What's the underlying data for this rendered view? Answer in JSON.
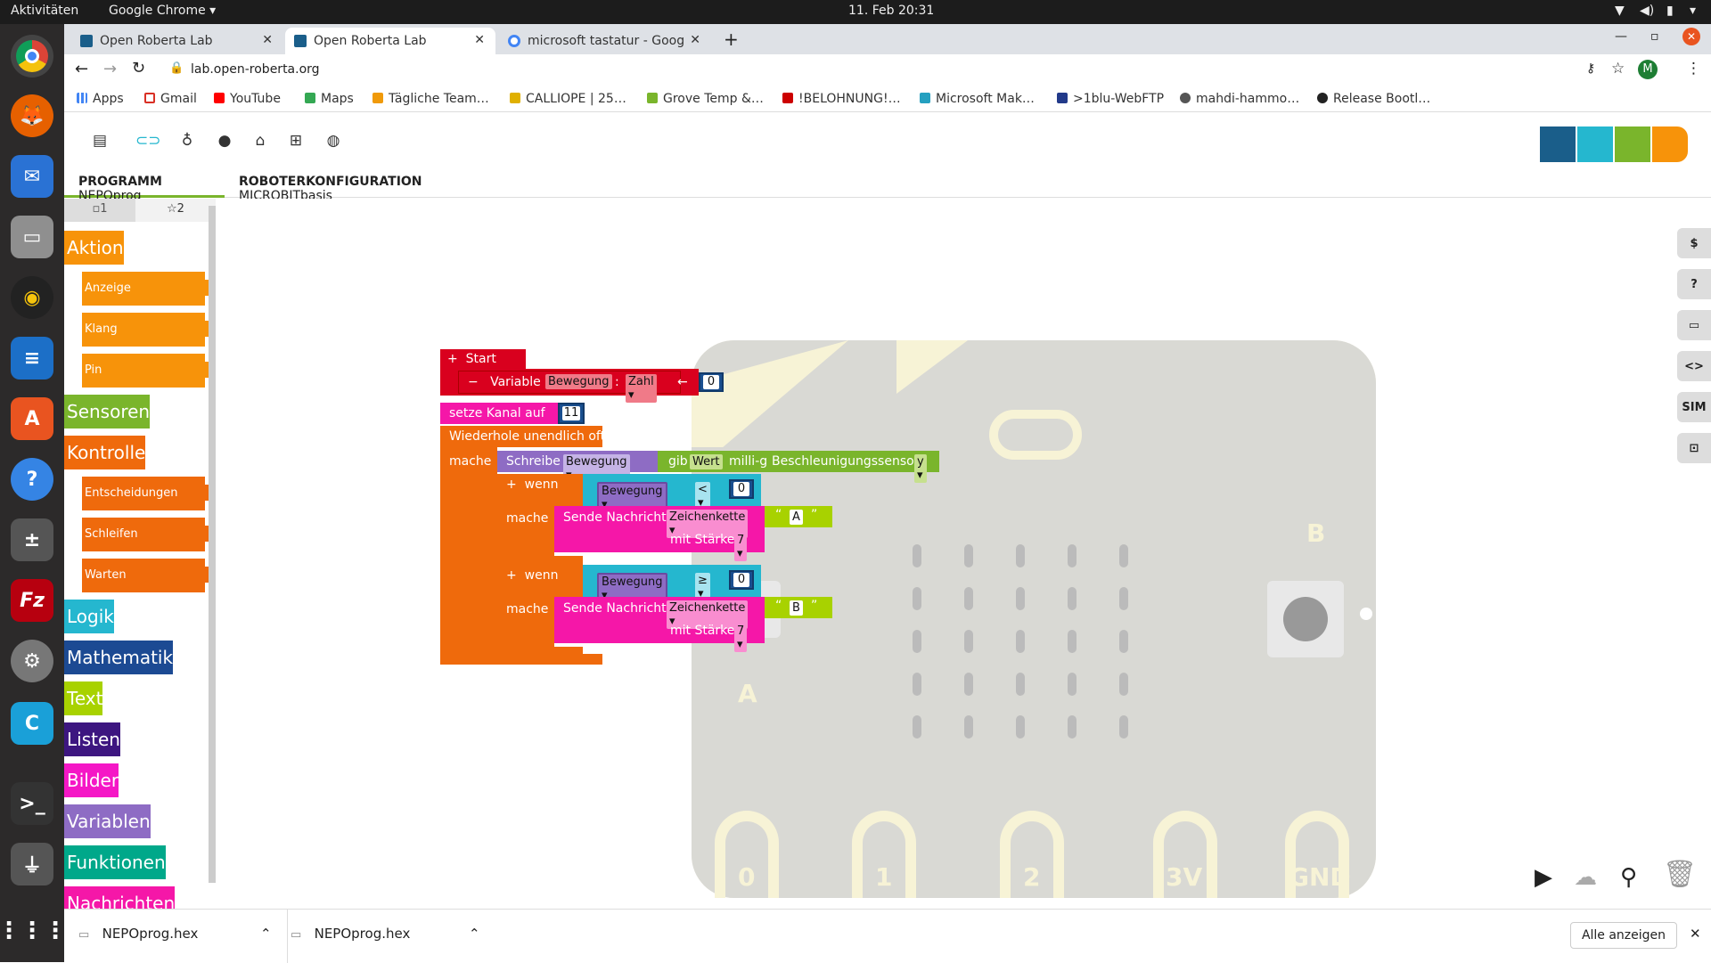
{
  "system": {
    "activities": "Aktivitäten",
    "app": "Google Chrome ▾",
    "datetime": "11. Feb  20:31"
  },
  "tabs": [
    {
      "title": "Open Roberta Lab"
    },
    {
      "title": "Open Roberta Lab"
    },
    {
      "title": "microsoft tastatur - Goog"
    }
  ],
  "address": {
    "url": "lab.open-roberta.org"
  },
  "profile": "M",
  "bookmarks": [
    "Apps",
    "Gmail",
    "YouTube",
    "Maps",
    "Tägliche Team…",
    "CALLIOPE | 25…",
    "Grove Temp &…",
    "!BELOHNUNG!…",
    "Microsoft Mak…",
    ">1blu-WebFTP",
    "mahdi-hammo…",
    "Release Bootl…"
  ],
  "program_tab": {
    "label": "PROGRAMM",
    "name": "NEPOprog"
  },
  "config_tab": {
    "label": "ROBOTERKONFIGURATION",
    "name": "MICROBITbasis"
  },
  "palette_tabs": [
    "▫1",
    "☆2"
  ],
  "palette": [
    {
      "label": "Aktion",
      "color": "#f7930a"
    },
    {
      "label": "Anzeige",
      "color": "#f7930a",
      "sub": true
    },
    {
      "label": "Klang",
      "color": "#f7930a",
      "sub": true
    },
    {
      "label": "Pin",
      "color": "#f7930a",
      "sub": true
    },
    {
      "label": "Sensoren",
      "color": "#7ab52c"
    },
    {
      "label": "Kontrolle",
      "color": "#ef6a0c"
    },
    {
      "label": "Entscheidungen",
      "color": "#ef6a0c",
      "sub": true
    },
    {
      "label": "Schleifen",
      "color": "#ef6a0c",
      "sub": true
    },
    {
      "label": "Warten",
      "color": "#ef6a0c",
      "sub": true
    },
    {
      "label": "Logik",
      "color": "#25b7cf"
    },
    {
      "label": "Mathematik",
      "color": "#1c4a93"
    },
    {
      "label": "Text",
      "color": "#a8d200"
    },
    {
      "label": "Listen",
      "color": "#3d1680"
    },
    {
      "label": "Bilder",
      "color": "#f517c6"
    },
    {
      "label": "Variablen",
      "color": "#8e6cc4"
    },
    {
      "label": "Funktionen",
      "color": "#00a88a"
    },
    {
      "label": "Nachrichten",
      "color": "#f517a8"
    }
  ],
  "program": {
    "start": "Start",
    "variable": "Variable",
    "var_name": "Bewegung",
    "colon": ":",
    "var_type": "Zahl ▾",
    "arrow": "←",
    "init_value": "0",
    "set_channel": "setze Kanal auf",
    "channel": "11",
    "loop": "Wiederhole unendlich oft",
    "do": "mache",
    "write": "Schreibe",
    "write_var": "Bewegung ▾",
    "get": "gib",
    "value": "Wert",
    "unit": "milli-g",
    "sensor": "Beschleunigungssensor",
    "axis": "y ▾",
    "if1": "wenn",
    "cmp_var": "Bewegung ▾",
    "op1": "< ▾",
    "cmp1": "0",
    "do1": "mache",
    "send": "Sende Nachricht",
    "send_type": "Zeichenkette ▾",
    "strength": "mit Stärke",
    "strength_val": "7 ▾",
    "msg1": "A",
    "if2": "wenn",
    "op2": "≥ ▾",
    "cmp2": "0",
    "do2": "mache",
    "msg2": "B",
    "quote_open": "“",
    "quote_close": "”"
  },
  "board": {
    "pins": [
      "0",
      "1",
      "2",
      "3V",
      "GND"
    ],
    "button_a": "A",
    "button_b": "B"
  },
  "right_buttons": [
    "$",
    "?",
    "▭",
    "<>",
    "SIM",
    "⊡"
  ],
  "downloads": {
    "files": [
      "NEPOprog.hex",
      "NEPOprog.hex"
    ],
    "show_all": "Alle anzeigen"
  }
}
